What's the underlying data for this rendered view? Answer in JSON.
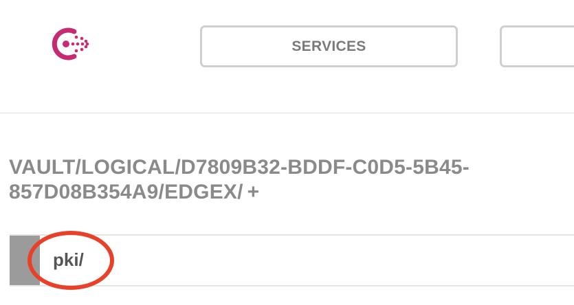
{
  "header": {
    "logo_icon": "consul-logo-icon",
    "brand_color": "#c62a71",
    "nav": {
      "services_label": "SERVICES",
      "next_label": ""
    }
  },
  "main": {
    "path_title": "VAULT/LOGICAL/D7809B32-BDDF-C0D5-5B45-857D08B354A9/EDGEX/",
    "add_label": "+",
    "list": [
      {
        "label": "pki/"
      }
    ]
  },
  "annotation": {
    "highlight_color": "#e8412a"
  }
}
